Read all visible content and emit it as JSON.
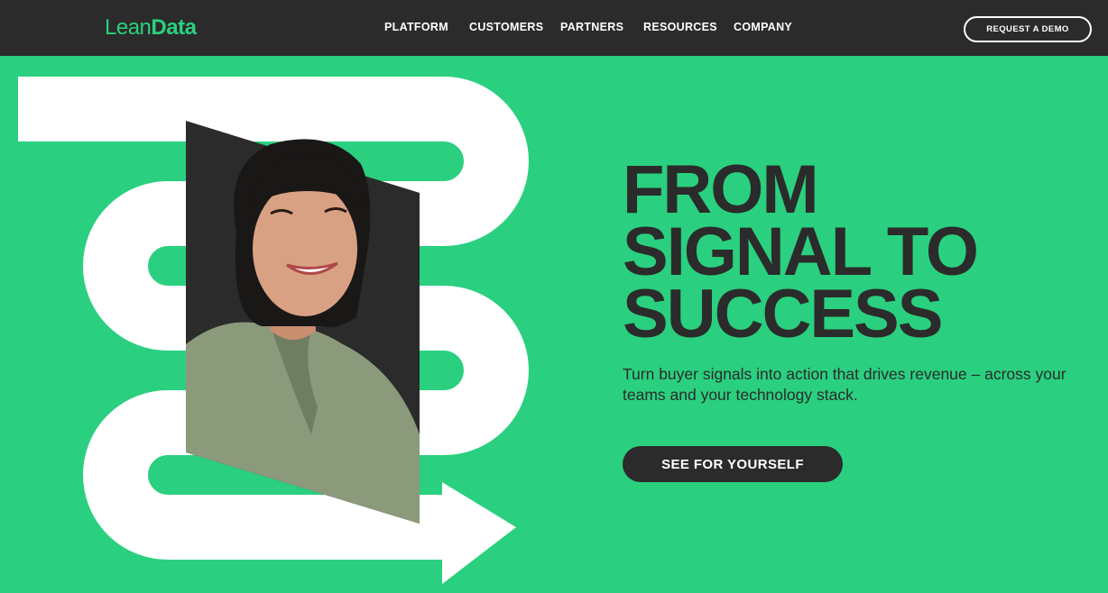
{
  "header": {
    "logo": {
      "part1": "Lean",
      "part2": "Data"
    },
    "nav": [
      {
        "label": "PLATFORM"
      },
      {
        "label": "CUSTOMERS"
      },
      {
        "label": "PARTNERS"
      },
      {
        "label": "RESOURCES"
      },
      {
        "label": "COMPANY"
      }
    ],
    "demo_button": "REQUEST A DEMO"
  },
  "hero": {
    "headline": [
      "FROM",
      "SIGNAL TO",
      "SUCCESS"
    ],
    "subtext": "Turn buyer signals into action that drives revenue – across your teams and your technology stack.",
    "cta": "SEE FOR YOURSELF",
    "image_alt": "smiling woman looking up"
  },
  "colors": {
    "brand_green": "#2ad07f",
    "dark": "#2b2b2b",
    "white": "#ffffff"
  }
}
